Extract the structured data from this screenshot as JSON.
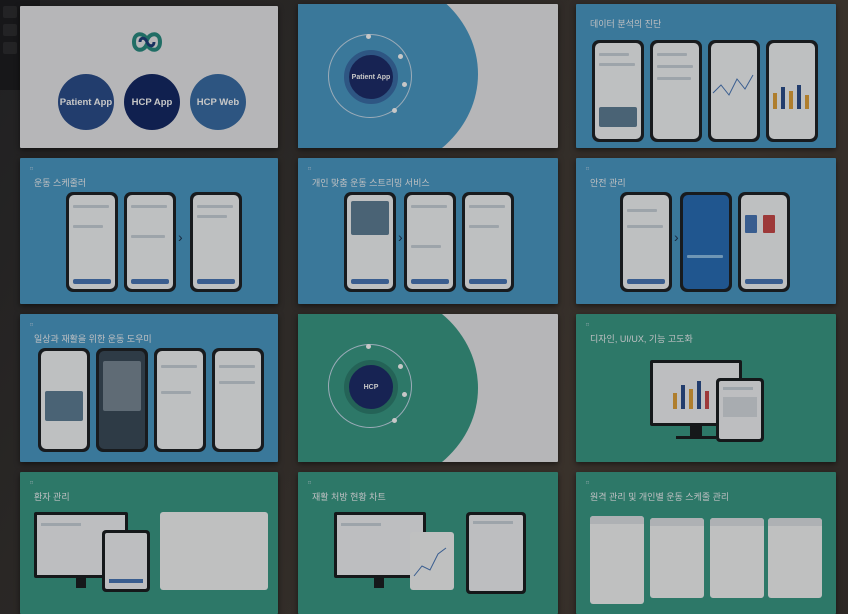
{
  "apps": {
    "patient": "Patient App",
    "hcp": "HCP App",
    "hcp_web": "HCP Web"
  },
  "slides": {
    "s2": {
      "bubble_title": "Patient App"
    },
    "s3": {
      "title": "데이터 분석의 진단"
    },
    "s4": {
      "title": "운동 스케줄러"
    },
    "s5": {
      "title": "개인 맞춤 운동 스트리밍 서비스"
    },
    "s6": {
      "title": "안전 관리"
    },
    "s7": {
      "title": "일상과 재활을 위한 운동 도우미"
    },
    "s8": {
      "bubble_title": "HCP"
    },
    "s9": {
      "title": "디자인, UI/UX, 기능 고도화"
    },
    "s10": {
      "title": "환자 관리"
    },
    "s11": {
      "title": "재활 처방 현황 차트"
    },
    "s12": {
      "title": "원격 관리 및 개인별 운동 스케줄 관리"
    }
  },
  "colors": {
    "slide_blue": "#4b9ac6",
    "slide_green": "#3a9a86",
    "slide_white": "#e9eaec",
    "navy": "#1e2d6b",
    "app_patient": "#2c4f8c",
    "app_hcp": "#152a66",
    "app_hcp_web": "#3a6ea6"
  }
}
